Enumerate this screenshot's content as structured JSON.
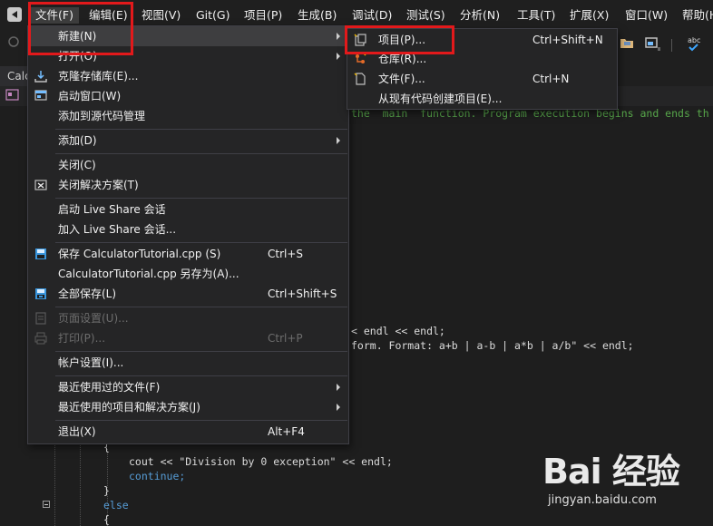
{
  "menubar": {
    "items": [
      "文件(F)",
      "编辑(E)",
      "视图(V)",
      "Git(G)",
      "项目(P)",
      "生成(B)",
      "调试(D)",
      "测试(S)",
      "分析(N)",
      "工具(T)",
      "扩展(X)",
      "窗口(W)",
      "帮助(H"
    ]
  },
  "editor": {
    "file_tab": "Calc",
    "code_lines": [
      {
        "text": "the  main  function. Program execution begins and ends th",
        "kind": "comment"
      },
      {
        "text": "< endl << endl;",
        "kind": "code"
      },
      {
        "text": "form. Format: a+b | a-b | a*b | a/b\" << endl;",
        "kind": "code"
      },
      {
        "text": "{",
        "kind": "code"
      },
      {
        "text": "cout << \"Division by 0 exception\" << endl;",
        "kind": "code"
      },
      {
        "text": "continue;",
        "kind": "code"
      },
      {
        "text": "}",
        "kind": "code"
      },
      {
        "text": "else",
        "kind": "code"
      },
      {
        "text": "{",
        "kind": "code"
      }
    ]
  },
  "file_menu": {
    "items": [
      {
        "label": "新建(N)",
        "shortcut": "",
        "submenu": true,
        "disabled": false,
        "icon": ""
      },
      {
        "label": "打开(O)",
        "shortcut": "",
        "submenu": true,
        "disabled": false,
        "icon": ""
      },
      {
        "label": "克隆存储库(E)...",
        "shortcut": "",
        "submenu": false,
        "disabled": false,
        "icon": "clone-icon"
      },
      {
        "label": "启动窗口(W)",
        "shortcut": "",
        "submenu": false,
        "disabled": false,
        "icon": "start-window-icon"
      },
      {
        "label": "添加到源代码管理",
        "shortcut": "",
        "submenu": false,
        "disabled": false,
        "icon": ""
      },
      {
        "label": "添加(D)",
        "shortcut": "",
        "submenu": true,
        "disabled": false,
        "icon": ""
      },
      {
        "label": "关闭(C)",
        "shortcut": "",
        "submenu": false,
        "disabled": false,
        "icon": ""
      },
      {
        "label": "关闭解决方案(T)",
        "shortcut": "",
        "submenu": false,
        "disabled": false,
        "icon": "close-solution-icon"
      },
      {
        "label": "启动 Live Share 会话",
        "shortcut": "",
        "submenu": false,
        "disabled": false,
        "icon": ""
      },
      {
        "label": "加入 Live Share 会话...",
        "shortcut": "",
        "submenu": false,
        "disabled": false,
        "icon": ""
      },
      {
        "label": "保存 CalculatorTutorial.cpp (S)",
        "shortcut": "Ctrl+S",
        "submenu": false,
        "disabled": false,
        "icon": "save-icon"
      },
      {
        "label": "CalculatorTutorial.cpp 另存为(A)...",
        "shortcut": "",
        "submenu": false,
        "disabled": false,
        "icon": ""
      },
      {
        "label": "全部保存(L)",
        "shortcut": "Ctrl+Shift+S",
        "submenu": false,
        "disabled": false,
        "icon": "save-all-icon"
      },
      {
        "label": "页面设置(U)...",
        "shortcut": "",
        "submenu": false,
        "disabled": true,
        "icon": "page-setup-icon"
      },
      {
        "label": "打印(P)...",
        "shortcut": "Ctrl+P",
        "submenu": false,
        "disabled": true,
        "icon": "print-icon"
      },
      {
        "label": "帐户设置(I)...",
        "shortcut": "",
        "submenu": false,
        "disabled": false,
        "icon": ""
      },
      {
        "label": "最近使用过的文件(F)",
        "shortcut": "",
        "submenu": true,
        "disabled": false,
        "icon": ""
      },
      {
        "label": "最近使用的项目和解决方案(J)",
        "shortcut": "",
        "submenu": true,
        "disabled": false,
        "icon": ""
      },
      {
        "label": "退出(X)",
        "shortcut": "Alt+F4",
        "submenu": false,
        "disabled": false,
        "icon": ""
      }
    ]
  },
  "new_submenu": {
    "items": [
      {
        "label": "项目(P)...",
        "shortcut": "Ctrl+Shift+N",
        "icon": "new-project-icon"
      },
      {
        "label": "仓库(R)...",
        "shortcut": "",
        "icon": "repository-icon"
      },
      {
        "label": "文件(F)...",
        "shortcut": "Ctrl+N",
        "icon": "new-file-icon"
      },
      {
        "label": "从现有代码创建项目(E)...",
        "shortcut": "",
        "icon": ""
      }
    ]
  },
  "watermark": {
    "logo": "Bai 经验",
    "url": "jingyan.baidu.com"
  },
  "colors": {
    "menu_bg": "#252526",
    "highlight": "#3e3e40",
    "annotation": "#e2191b",
    "comment": "#57a64a"
  }
}
